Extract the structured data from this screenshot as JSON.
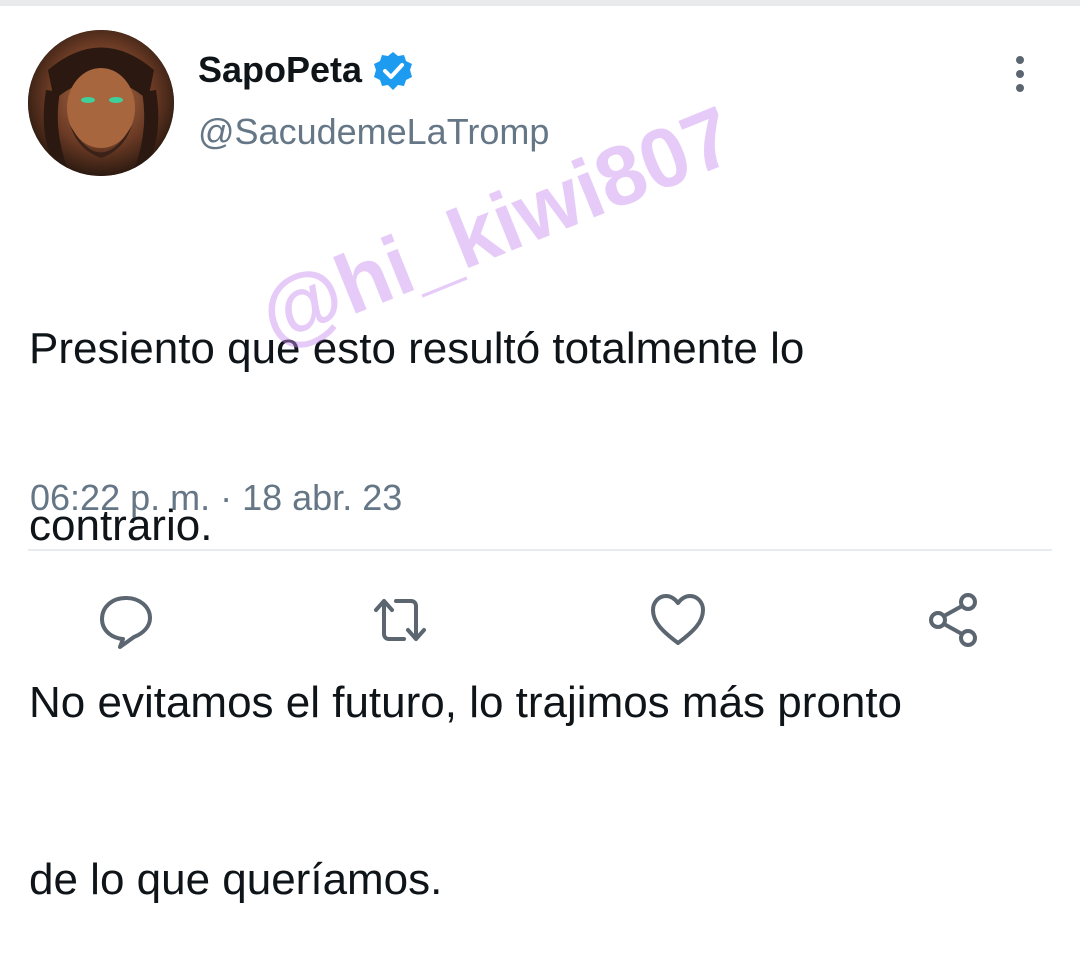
{
  "tweet": {
    "author": {
      "display_name": "SapoPeta",
      "handle": "@SacudemeLaTromp",
      "verified": true
    },
    "text_lines": [
      "Presiento que esto resultó totalmente lo",
      "contrario.",
      "No evitamos el futuro, lo trajimos más pronto",
      "de lo que queríamos."
    ],
    "timestamp": "06:22 p. m. · 18 abr. 23",
    "watermark": "@hi_kiwi807"
  },
  "icons": {
    "more": "more-vertical-icon",
    "reply": "reply-icon",
    "retweet": "retweet-icon",
    "like": "like-icon",
    "share": "share-icon",
    "verified": "verified-badge-icon"
  },
  "colors": {
    "text": "#0f1419",
    "secondary": "#657786",
    "icon": "#5b6670",
    "verified": "#1d9bf0",
    "watermark": "#c88cf0"
  }
}
